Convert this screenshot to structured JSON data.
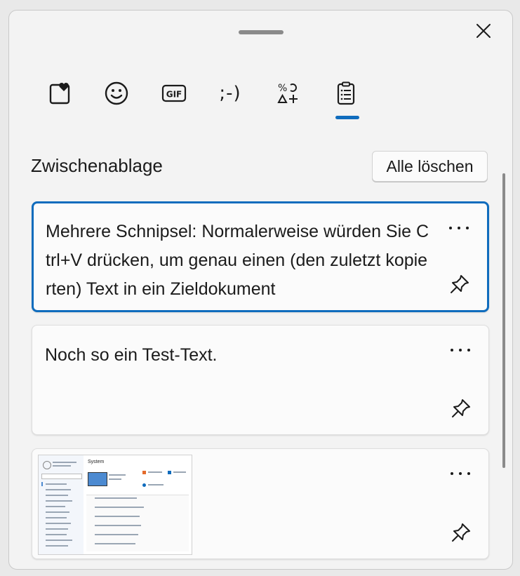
{
  "tabs": [
    {
      "name": "kaomoji-favorites",
      "icon": "favorites-heart-icon"
    },
    {
      "name": "emoji",
      "icon": "smiley-icon"
    },
    {
      "name": "gif",
      "icon": "gif-icon",
      "label": "GIF"
    },
    {
      "name": "kaomoji",
      "icon": "kaomoji-icon",
      "label": ";-)"
    },
    {
      "name": "symbols",
      "icon": "symbols-icon"
    },
    {
      "name": "clipboard",
      "icon": "clipboard-icon",
      "selected": true
    }
  ],
  "clipboard": {
    "title": "Zwischenablage",
    "clear_all": "Alle löschen",
    "items": [
      {
        "text": "Mehrere Schnipsel: Normalerweise würden Sie Ctrl+V drücken, um genau einen (den zuletzt kopierten) Text in ein Zieldokument"
      },
      {
        "text": "Noch so ein Test-Text."
      },
      {
        "text": "",
        "type": "image"
      }
    ]
  },
  "thumbnail": {
    "heading": "System"
  },
  "colors": {
    "accent": "#0f6cbd",
    "background": "#f3f3f3",
    "card": "#fbfbfb"
  }
}
